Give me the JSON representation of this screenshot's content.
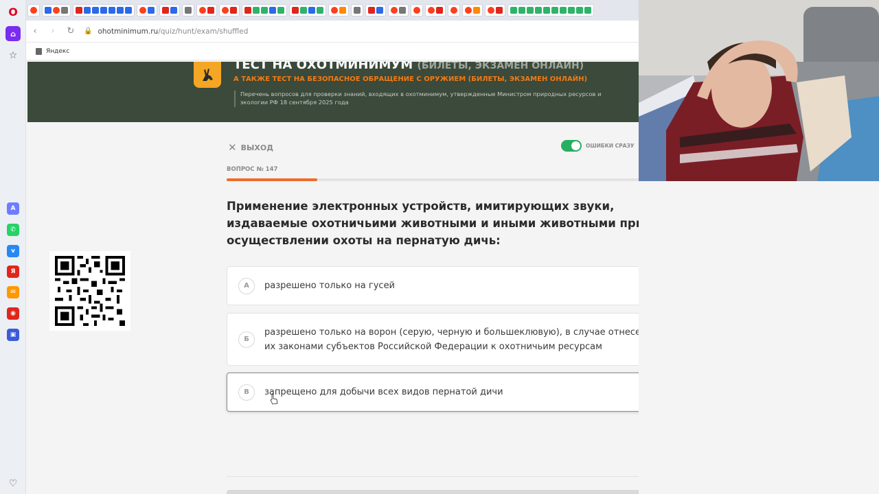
{
  "browser": {
    "url_domain": "ohotminimum.ru",
    "url_path": "/quiz/hunt/exam/shuffled",
    "bookmark_label": "Яндекс",
    "sidebar_icons": [
      "opera-icon",
      "home-icon",
      "star-icon",
      "heart-icon"
    ]
  },
  "banner": {
    "title": "ТЕСТ НА ОХОТМИНИМУМ",
    "title_sub": "(БИЛЕТЫ, ЭКЗАМЕН ОНЛАЙН)",
    "subtitle": "А ТАКЖЕ ТЕСТ НА БЕЗОПАСНОЕ ОБРАЩЕНИЕ С ОРУЖИЕМ (БИЛЕТЫ, ЭКЗАМЕН ОНЛАЙН)",
    "description": "Перечень вопросов для проверки знаний, входящих в охотминимум, утвержденные Министром природных ресурсов и экологии РФ 18 сентября 2025 года"
  },
  "controls": {
    "exit_label": "ВЫХОД",
    "toggle_label": "ОШИБКИ СРАЗУ",
    "toggle_on": true
  },
  "quiz": {
    "question_number": "ВОПРОС № 147",
    "progress_fraction": 0.2,
    "question": "Применение электронных устройств, имитирующих звуки, издаваемые охотничьими животными и иными животными при осуществлении охоты на пернатую дичь:",
    "answers": [
      {
        "letter": "А",
        "text": "разрешено только на гусей"
      },
      {
        "letter": "Б",
        "text": "разрешено только на ворон (серую, черную и большеклювую), в случае отнесения их законами субъектов Российской Федерации к охотничьим ресурсам"
      },
      {
        "letter": "В",
        "text": "запрещено для добычи всех видов пернатой дичи"
      }
    ]
  },
  "colors": {
    "accent_orange": "#f06a29",
    "banner_green": "#3b4a3a",
    "toggle_green": "#27ae60"
  }
}
